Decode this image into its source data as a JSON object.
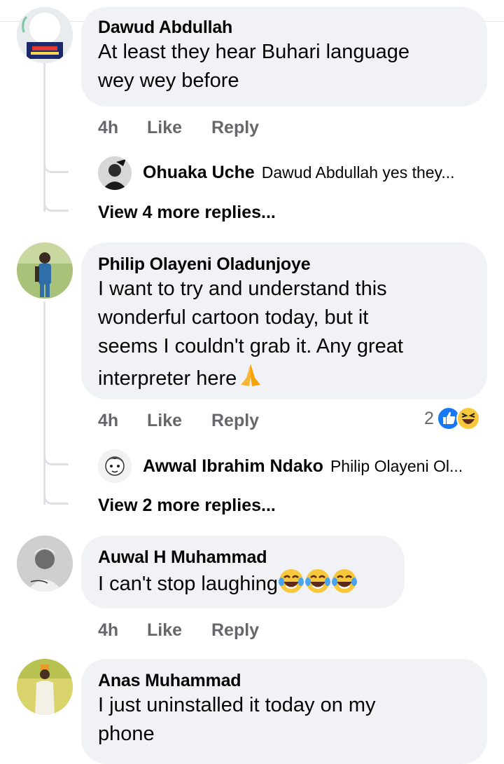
{
  "comments": [
    {
      "author": "Dawud Abdullah",
      "text_lines": [
        "At least they hear Buhari language",
        "wey wey before"
      ],
      "time": "4h",
      "like": "Like",
      "reply": "Reply",
      "reply_preview": {
        "author": "Ohuaka Uche",
        "text": "Dawud Abdullah yes they..."
      },
      "more_replies": "View 4 more replies..."
    },
    {
      "author": "Philip Olayeni Oladunjoye",
      "text_lines": [
        "I want to try and understand this",
        "wonderful cartoon today, but it",
        "seems I couldn't grab it. Any great",
        "interpreter here"
      ],
      "time": "4h",
      "like": "Like",
      "reply": "Reply",
      "reaction_count": "2",
      "reply_preview": {
        "author": "Awwal Ibrahim Ndako",
        "text": "Philip Olayeni Ol..."
      },
      "more_replies": "View 2 more replies..."
    },
    {
      "author": "Auwal H Muhammad",
      "text_lines": [
        "I can't stop laughing"
      ],
      "time": "4h",
      "like": "Like",
      "reply": "Reply"
    },
    {
      "author": "Anas Muhammad",
      "text_lines": [
        "I just uninstalled it today on my",
        "phone"
      ]
    }
  ],
  "icons": {
    "pray": "folded-hands-emoji",
    "laugh": "tears-of-joy-emoji",
    "like_reaction": "like-reaction-icon",
    "haha_reaction": "haha-reaction-icon"
  },
  "colors": {
    "bubble": "#f0f2f5",
    "meta": "#65676b",
    "text": "#050505",
    "like_blue": "#1877f2",
    "emoji_yellow": "#f7c83b"
  }
}
